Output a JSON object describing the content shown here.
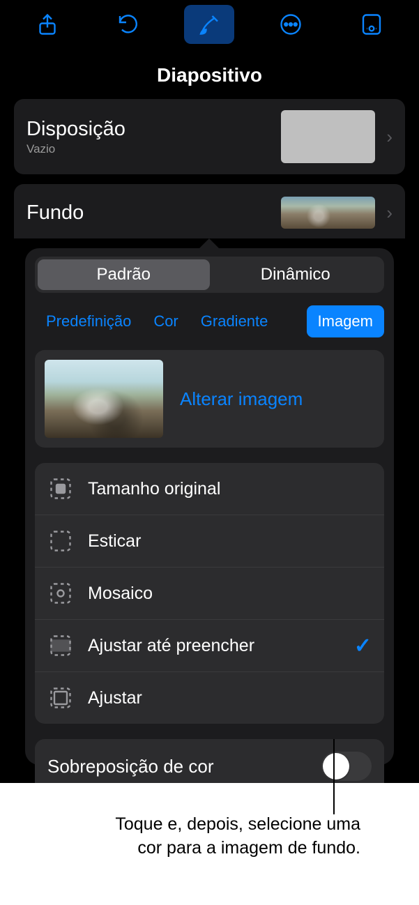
{
  "toolbar": {
    "share": "share-icon",
    "undo": "undo-icon",
    "format": "format-brush-icon",
    "more": "more-icon",
    "viewer": "viewer-icon"
  },
  "title": "Diapositivo",
  "layoutRow": {
    "title": "Disposição",
    "subtitle": "Vazio"
  },
  "backgroundRow": {
    "title": "Fundo"
  },
  "segmented": {
    "options": [
      "Padrão",
      "Dinâmico"
    ],
    "selected": 0
  },
  "fillTabs": {
    "items": [
      "Predefinição",
      "Cor",
      "Gradiente",
      "Imagem"
    ],
    "selected": 3
  },
  "imageCard": {
    "action": "Alterar imagem"
  },
  "scaleOptions": {
    "items": [
      "Tamanho original",
      "Esticar",
      "Mosaico",
      "Ajustar até preencher",
      "Ajustar"
    ],
    "selected": 3
  },
  "overlay": {
    "label": "Sobreposição de cor",
    "on": false
  },
  "callout": "Toque e, depois, selecione uma cor para a imagem de fundo."
}
